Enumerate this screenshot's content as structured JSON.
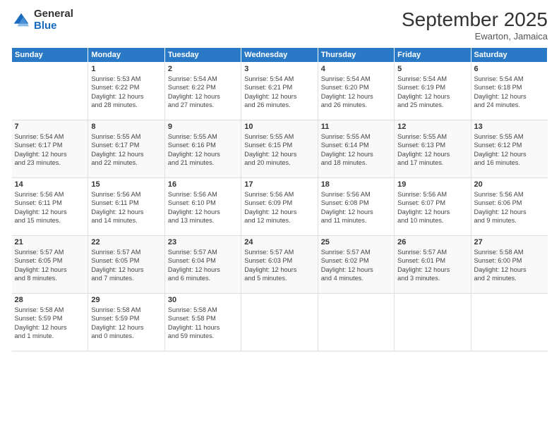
{
  "logo": {
    "general": "General",
    "blue": "Blue"
  },
  "header": {
    "month": "September 2025",
    "location": "Ewarton, Jamaica"
  },
  "days": [
    "Sunday",
    "Monday",
    "Tuesday",
    "Wednesday",
    "Thursday",
    "Friday",
    "Saturday"
  ],
  "weeks": [
    [
      {
        "day": "",
        "content": ""
      },
      {
        "day": "1",
        "content": "Sunrise: 5:53 AM\nSunset: 6:22 PM\nDaylight: 12 hours\nand 28 minutes."
      },
      {
        "day": "2",
        "content": "Sunrise: 5:54 AM\nSunset: 6:22 PM\nDaylight: 12 hours\nand 27 minutes."
      },
      {
        "day": "3",
        "content": "Sunrise: 5:54 AM\nSunset: 6:21 PM\nDaylight: 12 hours\nand 26 minutes."
      },
      {
        "day": "4",
        "content": "Sunrise: 5:54 AM\nSunset: 6:20 PM\nDaylight: 12 hours\nand 26 minutes."
      },
      {
        "day": "5",
        "content": "Sunrise: 5:54 AM\nSunset: 6:19 PM\nDaylight: 12 hours\nand 25 minutes."
      },
      {
        "day": "6",
        "content": "Sunrise: 5:54 AM\nSunset: 6:18 PM\nDaylight: 12 hours\nand 24 minutes."
      }
    ],
    [
      {
        "day": "7",
        "content": "Sunrise: 5:54 AM\nSunset: 6:17 PM\nDaylight: 12 hours\nand 23 minutes."
      },
      {
        "day": "8",
        "content": "Sunrise: 5:55 AM\nSunset: 6:17 PM\nDaylight: 12 hours\nand 22 minutes."
      },
      {
        "day": "9",
        "content": "Sunrise: 5:55 AM\nSunset: 6:16 PM\nDaylight: 12 hours\nand 21 minutes."
      },
      {
        "day": "10",
        "content": "Sunrise: 5:55 AM\nSunset: 6:15 PM\nDaylight: 12 hours\nand 20 minutes."
      },
      {
        "day": "11",
        "content": "Sunrise: 5:55 AM\nSunset: 6:14 PM\nDaylight: 12 hours\nand 18 minutes."
      },
      {
        "day": "12",
        "content": "Sunrise: 5:55 AM\nSunset: 6:13 PM\nDaylight: 12 hours\nand 17 minutes."
      },
      {
        "day": "13",
        "content": "Sunrise: 5:55 AM\nSunset: 6:12 PM\nDaylight: 12 hours\nand 16 minutes."
      }
    ],
    [
      {
        "day": "14",
        "content": "Sunrise: 5:56 AM\nSunset: 6:11 PM\nDaylight: 12 hours\nand 15 minutes."
      },
      {
        "day": "15",
        "content": "Sunrise: 5:56 AM\nSunset: 6:11 PM\nDaylight: 12 hours\nand 14 minutes."
      },
      {
        "day": "16",
        "content": "Sunrise: 5:56 AM\nSunset: 6:10 PM\nDaylight: 12 hours\nand 13 minutes."
      },
      {
        "day": "17",
        "content": "Sunrise: 5:56 AM\nSunset: 6:09 PM\nDaylight: 12 hours\nand 12 minutes."
      },
      {
        "day": "18",
        "content": "Sunrise: 5:56 AM\nSunset: 6:08 PM\nDaylight: 12 hours\nand 11 minutes."
      },
      {
        "day": "19",
        "content": "Sunrise: 5:56 AM\nSunset: 6:07 PM\nDaylight: 12 hours\nand 10 minutes."
      },
      {
        "day": "20",
        "content": "Sunrise: 5:56 AM\nSunset: 6:06 PM\nDaylight: 12 hours\nand 9 minutes."
      }
    ],
    [
      {
        "day": "21",
        "content": "Sunrise: 5:57 AM\nSunset: 6:05 PM\nDaylight: 12 hours\nand 8 minutes."
      },
      {
        "day": "22",
        "content": "Sunrise: 5:57 AM\nSunset: 6:05 PM\nDaylight: 12 hours\nand 7 minutes."
      },
      {
        "day": "23",
        "content": "Sunrise: 5:57 AM\nSunset: 6:04 PM\nDaylight: 12 hours\nand 6 minutes."
      },
      {
        "day": "24",
        "content": "Sunrise: 5:57 AM\nSunset: 6:03 PM\nDaylight: 12 hours\nand 5 minutes."
      },
      {
        "day": "25",
        "content": "Sunrise: 5:57 AM\nSunset: 6:02 PM\nDaylight: 12 hours\nand 4 minutes."
      },
      {
        "day": "26",
        "content": "Sunrise: 5:57 AM\nSunset: 6:01 PM\nDaylight: 12 hours\nand 3 minutes."
      },
      {
        "day": "27",
        "content": "Sunrise: 5:58 AM\nSunset: 6:00 PM\nDaylight: 12 hours\nand 2 minutes."
      }
    ],
    [
      {
        "day": "28",
        "content": "Sunrise: 5:58 AM\nSunset: 5:59 PM\nDaylight: 12 hours\nand 1 minute."
      },
      {
        "day": "29",
        "content": "Sunrise: 5:58 AM\nSunset: 5:59 PM\nDaylight: 12 hours\nand 0 minutes."
      },
      {
        "day": "30",
        "content": "Sunrise: 5:58 AM\nSunset: 5:58 PM\nDaylight: 11 hours\nand 59 minutes."
      },
      {
        "day": "",
        "content": ""
      },
      {
        "day": "",
        "content": ""
      },
      {
        "day": "",
        "content": ""
      },
      {
        "day": "",
        "content": ""
      }
    ]
  ]
}
